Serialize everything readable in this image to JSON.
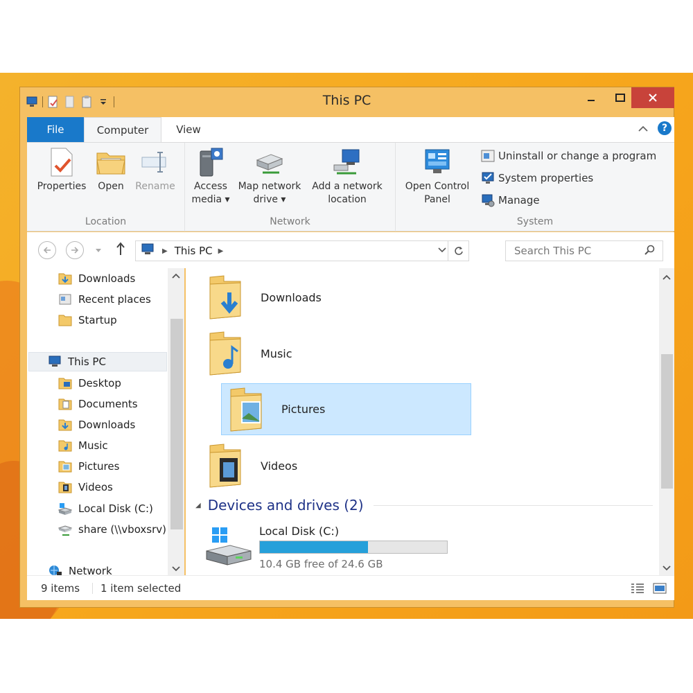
{
  "window": {
    "title": "This PC"
  },
  "ribbon": {
    "tabs": {
      "file": "File",
      "computer": "Computer",
      "view": "View"
    },
    "location": {
      "label": "Location",
      "properties": "Properties",
      "open": "Open",
      "rename": "Rename"
    },
    "network": {
      "label": "Network",
      "access_media_1": "Access",
      "access_media_2": "media ▾",
      "map_drive_1": "Map network",
      "map_drive_2": "drive ▾",
      "add_location_1": "Add a network",
      "add_location_2": "location"
    },
    "system": {
      "label": "System",
      "control_panel_1": "Open Control",
      "control_panel_2": "Panel",
      "uninstall": "Uninstall or change a program",
      "sys_props": "System properties",
      "manage": "Manage"
    }
  },
  "address": {
    "crumb": "This PC",
    "search_placeholder": "Search This PC"
  },
  "nav": {
    "items": [
      "Downloads",
      "Recent places",
      "Startup",
      "This PC",
      "Desktop",
      "Documents",
      "Downloads",
      "Music",
      "Pictures",
      "Videos",
      "Local Disk (C:)",
      "share (\\\\vboxsrv)",
      "Network"
    ]
  },
  "content": {
    "folders": [
      "Downloads",
      "Music",
      "Pictures",
      "Videos"
    ],
    "section_title": "Devices and drives (2)",
    "drive": {
      "name": "Local Disk (C:)",
      "free_text": "10.4 GB free of 24.6 GB",
      "used_fraction": 0.577
    }
  },
  "status": {
    "items": "9 items",
    "selected": "1 item selected"
  },
  "colors": {
    "accent": "#1979ca",
    "selection": "#cce8ff",
    "drive_bar": "#26a0da",
    "window_frame": "#f5c064",
    "close_button": "#c8433a"
  }
}
